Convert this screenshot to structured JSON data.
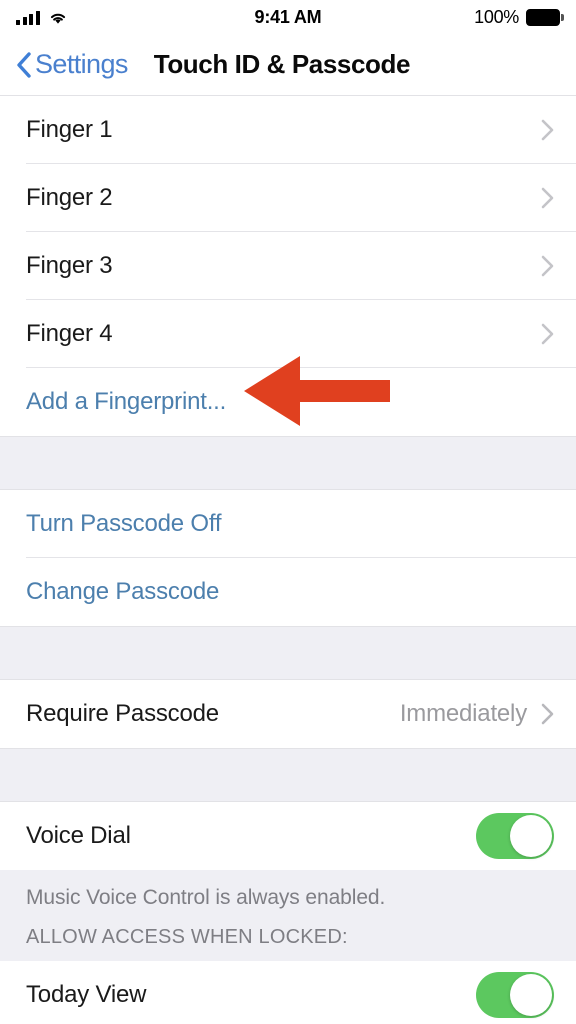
{
  "status_bar": {
    "signal_icon": "cellular-signal-icon",
    "wifi_icon": "wifi-icon",
    "time": "9:41 AM",
    "battery_percent": "100%",
    "battery_icon": "battery-full-icon"
  },
  "nav": {
    "back_icon": "chevron-left-icon",
    "back_label": "Settings",
    "title": "Touch ID & Passcode"
  },
  "sections": {
    "fingerprints": {
      "rows": [
        {
          "label": "Finger 1",
          "accessory": "chevron-right-icon"
        },
        {
          "label": "Finger 2",
          "accessory": "chevron-right-icon"
        },
        {
          "label": "Finger 3",
          "accessory": "chevron-right-icon"
        },
        {
          "label": "Finger 4",
          "accessory": "chevron-right-icon"
        }
      ],
      "add_label": "Add a Fingerprint..."
    },
    "passcode": {
      "turn_off_label": "Turn Passcode Off",
      "change_label": "Change Passcode"
    },
    "require": {
      "label": "Require Passcode",
      "value": "Immediately",
      "accessory": "chevron-right-icon"
    },
    "voice_dial": {
      "label": "Voice Dial",
      "toggle_state": "on",
      "footer": "Music Voice Control is always enabled."
    },
    "allow_access": {
      "header": "ALLOW ACCESS WHEN LOCKED:",
      "rows": [
        {
          "label": "Today View",
          "toggle_state": "on"
        }
      ]
    }
  },
  "annotation": {
    "arrow_icon": "left-arrow-annotation-icon",
    "arrow_color": "#E0401F",
    "points_at": "Add a Fingerprint..."
  },
  "colors": {
    "link_blue": "#4C7FAD",
    "nav_blue": "#4A80CE",
    "toggle_green": "#5CC85F",
    "grouped_background": "#EFEFF4",
    "value_gray": "#9A9A9E"
  }
}
